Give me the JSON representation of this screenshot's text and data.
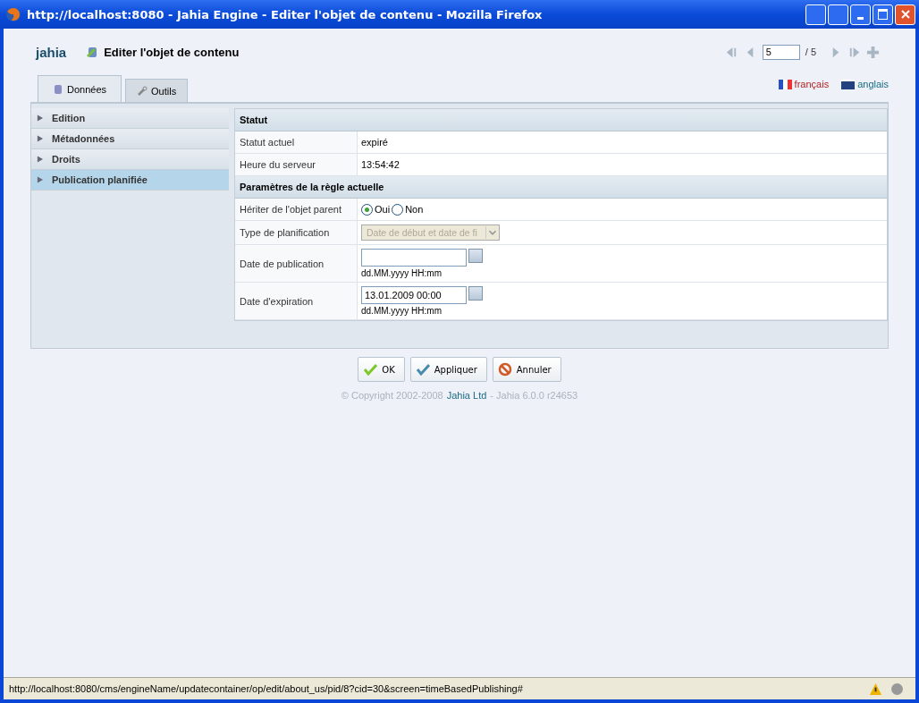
{
  "window": {
    "title": "http://localhost:8080 - Jahia Engine - Editer l'objet de contenu - Mozilla Firefox"
  },
  "header": {
    "logo": "jahia",
    "title": "Editer l'objet de contenu",
    "pager": {
      "page": "5",
      "total": "/ 5"
    }
  },
  "tabs": [
    {
      "label": "Données",
      "selected": true
    },
    {
      "label": "Outils",
      "selected": false
    }
  ],
  "languages": [
    {
      "label": "français",
      "selected": true
    },
    {
      "label": "anglais",
      "selected": false
    }
  ],
  "sidebar": {
    "items": [
      {
        "label": "Edition",
        "selected": false
      },
      {
        "label": "Métadonnées",
        "selected": false
      },
      {
        "label": "Droits",
        "selected": false
      },
      {
        "label": "Publication planifiée",
        "selected": true
      }
    ]
  },
  "sections": [
    {
      "title": "Statut",
      "rows": [
        {
          "kind": "text",
          "label": "Statut actuel",
          "value": "expiré"
        },
        {
          "kind": "text",
          "label": "Heure du serveur",
          "value": "13:54:42"
        }
      ]
    },
    {
      "title": "Paramètres de la règle actuelle",
      "rows": [
        {
          "kind": "radio",
          "label": "Hériter de l'objet parent",
          "options": [
            {
              "label": "Oui",
              "selected": true
            },
            {
              "label": "Non",
              "selected": false
            }
          ]
        },
        {
          "kind": "select",
          "label": "Type de planification",
          "value": "Date de début et date de fi",
          "disabled": true
        },
        {
          "kind": "date",
          "label": "Date de publication",
          "hint": "dd.MM.yyyy HH:mm"
        },
        {
          "kind": "date",
          "label": "Date d'expiration",
          "value": "13.01.2009 00:00",
          "hint": "dd.MM.yyyy HH:mm"
        }
      ]
    }
  ],
  "buttons": [
    {
      "label": "OK",
      "kind": "ok"
    },
    {
      "label": "Appliquer",
      "kind": "apply"
    },
    {
      "label": "Annuler",
      "kind": "cancel"
    }
  ],
  "footer": {
    "copyright": "© Copyright 2002-2008",
    "link": "Jahia Ltd",
    "version": "- Jahia 6.0.0 r24653"
  },
  "status_bar": {
    "url": "http://localhost:8080/cms/engineName/updatecontainer/op/edit/about_us/pid/8?cid=30&screen=timeBasedPublishing#"
  }
}
